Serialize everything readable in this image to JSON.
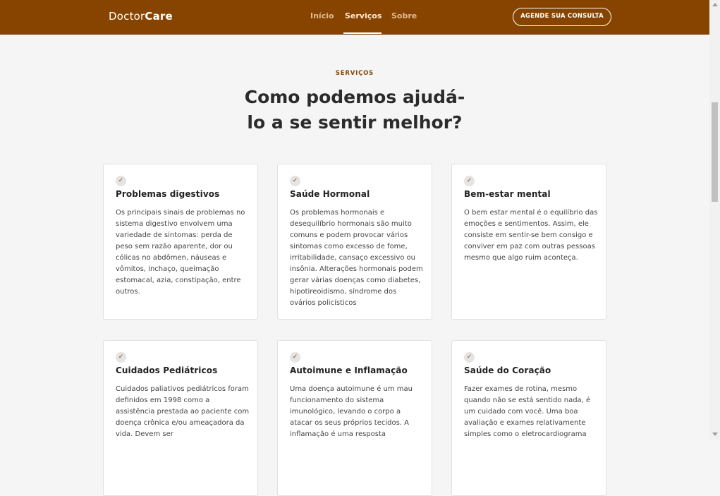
{
  "header": {
    "logo_regular": "Doctor",
    "logo_bold": "Care",
    "nav": [
      {
        "label": "Início"
      },
      {
        "label": "Serviços"
      },
      {
        "label": "Sobre"
      }
    ],
    "cta_label": "AGENDE SUA CONSULTA",
    "colors": {
      "background": "#874400",
      "nav_text": "#e0b98f"
    }
  },
  "section": {
    "eyebrow": "SERVIÇOS",
    "title_line1": "Como podemos ajudá-",
    "title_line2": "lo a se sentir melhor?"
  },
  "cards": [
    {
      "icon": "check-icon",
      "title": "Problemas digestivos",
      "text": "Os principais sinais de problemas no sistema digestivo envolvem uma variedade de sintomas: perda de peso sem razão aparente, dor ou cólicas no abdômen, náuseas e vômitos, inchaço, queimação estomacal, azia, constipação, entre outros."
    },
    {
      "icon": "check-icon",
      "title": "Saúde Hormonal",
      "text": "Os problemas hormonais e desequilíbrio hormonais são muito comuns e podem provocar vários sintomas como excesso de fome, irritabilidade, cansaço excessivo ou insônia. Alterações hormonais podem gerar várias doenças como diabetes, hipotireoidismo, síndrome dos ovários policísticos"
    },
    {
      "icon": "check-icon",
      "title": "Bem-estar mental",
      "text": "O bem estar mental é o equilíbrio das emoções e sentimentos. Assim, ele consiste em sentir-se bem consigo e conviver em paz com outras pessoas mesmo que algo ruim aconteça."
    },
    {
      "icon": "check-icon",
      "title": "Cuidados Pediátricos",
      "text": "Cuidados paliativos pediátricos foram definidos em 1998 como a assistência prestada ao paciente com doença crônica e/ou ameaçadora da vida. Devem ser"
    },
    {
      "icon": "check-icon",
      "title": "Autoimune e Inflamação",
      "text": "Uma doença autoimune é um mau funcionamento do sistema imunológico, levando o corpo a atacar os seus próprios tecidos. A inflamação é uma resposta"
    },
    {
      "icon": "check-icon",
      "title": "Saúde do Coração",
      "text": "Fazer exames de rotina, mesmo quando não se está sentido nada, é um cuidado com você. Uma boa avaliação e exames relativamente simples como o eletrocardiograma"
    }
  ],
  "accent_color": "#874400"
}
